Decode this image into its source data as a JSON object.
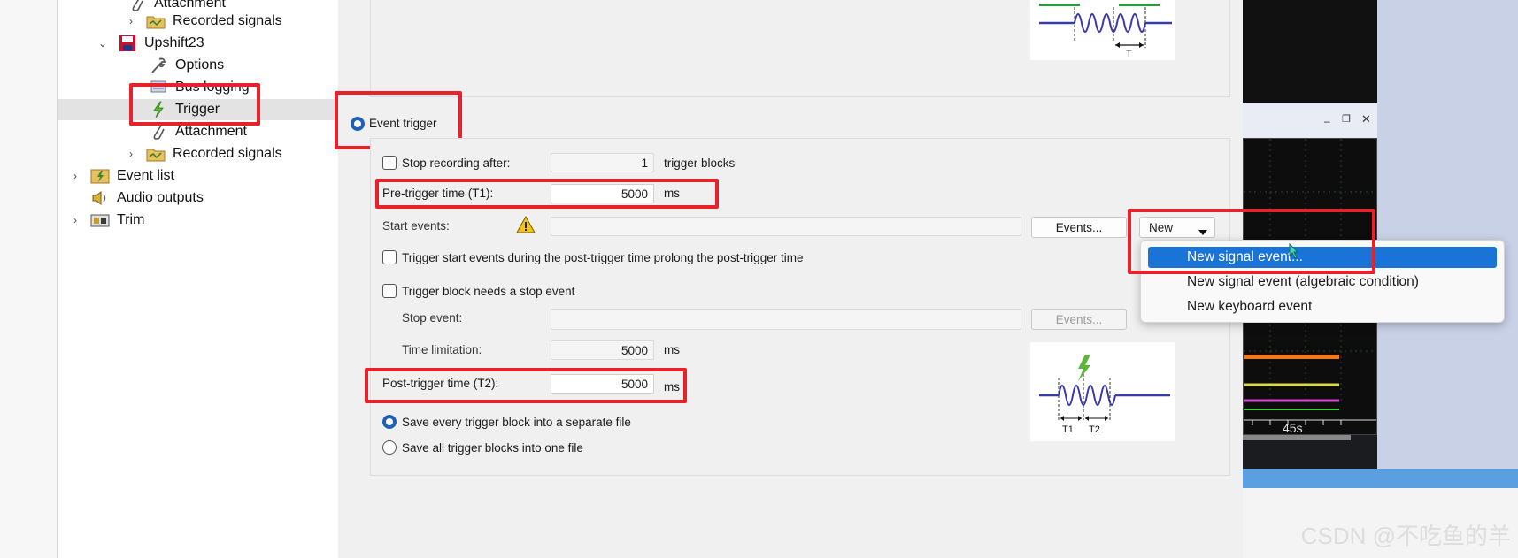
{
  "tree": {
    "items": [
      {
        "label": "Attachment",
        "icon": "paperclip-icon"
      },
      {
        "label": "Recorded signals",
        "icon": "folder-icon"
      },
      {
        "label": "Upshift23",
        "icon": "save-icon"
      },
      {
        "label": "Options",
        "icon": "wrench-icon"
      },
      {
        "label": "Bus logging",
        "icon": "bus-logging-icon"
      },
      {
        "label": "Trigger",
        "icon": "lightning-icon"
      },
      {
        "label": "Attachment",
        "icon": "paperclip-icon"
      },
      {
        "label": "Recorded signals",
        "icon": "folder-icon"
      },
      {
        "label": "Event list",
        "icon": "event-list-icon"
      },
      {
        "label": "Audio outputs",
        "icon": "speaker-icon"
      },
      {
        "label": "Trim",
        "icon": "trim-icon"
      }
    ]
  },
  "event_trigger": {
    "label": "Event trigger",
    "stop_recording_label": "Stop recording after:",
    "stop_recording_value": "1",
    "stop_recording_unit": "trigger blocks",
    "pre_trigger_label": "Pre-trigger time (T1):",
    "pre_trigger_value": "5000",
    "pre_trigger_unit": "ms",
    "start_events_label": "Start events:",
    "events_button": "Events...",
    "new_button": "New",
    "prolong_label": "Trigger start events during the post-trigger time prolong the post-trigger time",
    "needs_stop_label": "Trigger block needs a stop event",
    "stop_event_label": "Stop event:",
    "stop_events_button": "Events...",
    "time_limit_label": "Time limitation:",
    "time_limit_value": "5000",
    "time_limit_unit": "ms",
    "post_trigger_label": "Post-trigger time (T2):",
    "post_trigger_value": "5000",
    "post_trigger_unit": "ms",
    "save_separate_label": "Save every trigger block into a separate file",
    "save_one_label": "Save all trigger blocks into one file"
  },
  "diagrams": {
    "top_label": "T",
    "bottom_t1": "T1",
    "bottom_t2": "T2"
  },
  "new_menu": {
    "items": [
      {
        "label": "New signal event...",
        "highlighted": true
      },
      {
        "label": "New signal event (algebraic condition)",
        "highlighted": false
      },
      {
        "label": "New keyboard event",
        "highlighted": false
      }
    ]
  },
  "background_window": {
    "time_tick": "45s"
  },
  "watermark": "CSDN @不吃鱼的羊",
  "colors": {
    "highlight": "#1a73d6",
    "annotation_red": "#e8222a",
    "radio_blue": "#1e5fb8"
  }
}
